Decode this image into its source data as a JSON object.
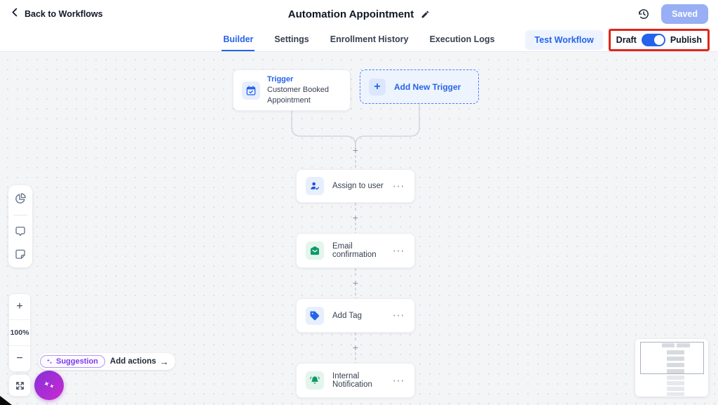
{
  "header": {
    "back_label": "Back to Workflows",
    "title": "Automation Appointment",
    "saved_label": "Saved"
  },
  "tabs": {
    "items": [
      {
        "label": "Builder"
      },
      {
        "label": "Settings"
      },
      {
        "label": "Enrollment History"
      },
      {
        "label": "Execution Logs"
      }
    ],
    "active_tab": "Builder",
    "test_workflow_label": "Test Workflow",
    "draft_label": "Draft",
    "publish_label": "Publish",
    "publish_toggle_state": "on"
  },
  "canvas": {
    "trigger_card": {
      "kicker": "Trigger",
      "title": "Customer Booked Appointment",
      "icon": "calendar-check-icon"
    },
    "add_trigger": {
      "label": "Add New Trigger",
      "plus": "+"
    },
    "plus_symbol": "+",
    "nodes": [
      {
        "label": "Assign to user",
        "icon": "user-check-icon",
        "scheme": "blue",
        "menu": "···"
      },
      {
        "label": "Email confirmation",
        "icon": "mail-icon",
        "scheme": "green",
        "menu": "···"
      },
      {
        "label": "Add Tag",
        "icon": "tag-icon",
        "scheme": "blue",
        "menu": "···"
      },
      {
        "label": "Internal Notification",
        "icon": "bell-icon",
        "scheme": "green",
        "menu": "···"
      }
    ]
  },
  "toolbox": {
    "icons": [
      "pie-chart-icon",
      "comment-icon",
      "note-icon"
    ]
  },
  "zoom_controls": {
    "zoom_in": "+",
    "zoom_level": "100%",
    "zoom_out": "−"
  },
  "suggestion": {
    "badge": "Suggestion",
    "action": "Add actions",
    "arrow": "→"
  },
  "colors": {
    "accent_blue": "#2563eb",
    "saved_button": "#98aef5",
    "action_green": "#0b9b66",
    "annotation_red": "#e0261c",
    "canvas_bg": "#f4f5f7"
  }
}
